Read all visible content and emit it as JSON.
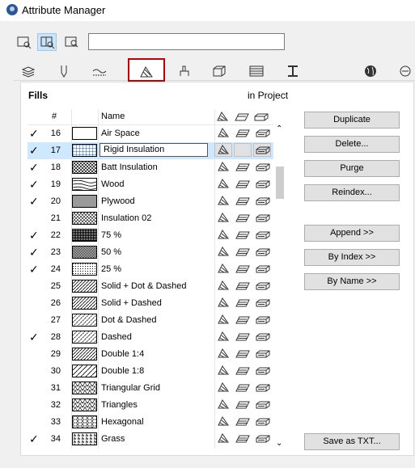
{
  "window": {
    "title": "Attribute Manager"
  },
  "search": {
    "value": ""
  },
  "panel": {
    "list_label": "Fills",
    "in_project_label": "in Project"
  },
  "columns": {
    "index": "#",
    "name": "Name"
  },
  "tabs": [
    {
      "name": "layers-icon"
    },
    {
      "name": "pen-icon"
    },
    {
      "name": "line-types-icon"
    },
    {
      "name": "fills-icon",
      "selected": true
    },
    {
      "name": "surfaces-icon"
    },
    {
      "name": "building-materials-icon"
    },
    {
      "name": "composites-icon"
    },
    {
      "name": "profiles-icon"
    },
    {
      "name": "zone-categories-icon"
    },
    {
      "name": "mep-icon"
    }
  ],
  "fills": [
    {
      "index": "16",
      "name": "Air Space",
      "checked": true,
      "pattern": "empty"
    },
    {
      "index": "17",
      "name": "Rigid Insulation",
      "checked": true,
      "pattern": "grid",
      "selected": true
    },
    {
      "index": "18",
      "name": "Batt Insulation",
      "checked": true,
      "pattern": "crosshatch"
    },
    {
      "index": "19",
      "name": "Wood",
      "checked": true,
      "pattern": "wood"
    },
    {
      "index": "20",
      "name": "Plywood",
      "checked": true,
      "pattern": "hlines"
    },
    {
      "index": "21",
      "name": "Insulation 02",
      "checked": false,
      "pattern": "zigzag"
    },
    {
      "index": "22",
      "name": "75 %",
      "checked": true,
      "pattern": "dense"
    },
    {
      "index": "23",
      "name": "50 %",
      "checked": true,
      "pattern": "medium"
    },
    {
      "index": "24",
      "name": "25 %",
      "checked": true,
      "pattern": "light"
    },
    {
      "index": "25",
      "name": "Solid + Dot & Dashed",
      "checked": false,
      "pattern": "diag"
    },
    {
      "index": "26",
      "name": "Solid + Dashed",
      "checked": false,
      "pattern": "diag"
    },
    {
      "index": "27",
      "name": "Dot & Dashed",
      "checked": false,
      "pattern": "diagdash"
    },
    {
      "index": "28",
      "name": "Dashed",
      "checked": true,
      "pattern": "diagdash"
    },
    {
      "index": "29",
      "name": "Double 1:4",
      "checked": false,
      "pattern": "diag"
    },
    {
      "index": "30",
      "name": "Double 1:8",
      "checked": false,
      "pattern": "diagwide"
    },
    {
      "index": "31",
      "name": "Triangular Grid",
      "checked": false,
      "pattern": "tri"
    },
    {
      "index": "32",
      "name": "Triangles",
      "checked": false,
      "pattern": "tri"
    },
    {
      "index": "33",
      "name": "Hexagonal",
      "checked": false,
      "pattern": "hex"
    },
    {
      "index": "34",
      "name": "Grass",
      "checked": true,
      "pattern": "grass"
    }
  ],
  "buttons": {
    "duplicate": "Duplicate",
    "delete": "Delete...",
    "purge": "Purge",
    "reindex": "Reindex...",
    "append": "Append >>",
    "by_index": "By Index >>",
    "by_name": "By Name >>",
    "save_txt": "Save as TXT..."
  },
  "colors": {
    "selected_row": "#cde8ff",
    "tab_highlight": "#c00000"
  }
}
